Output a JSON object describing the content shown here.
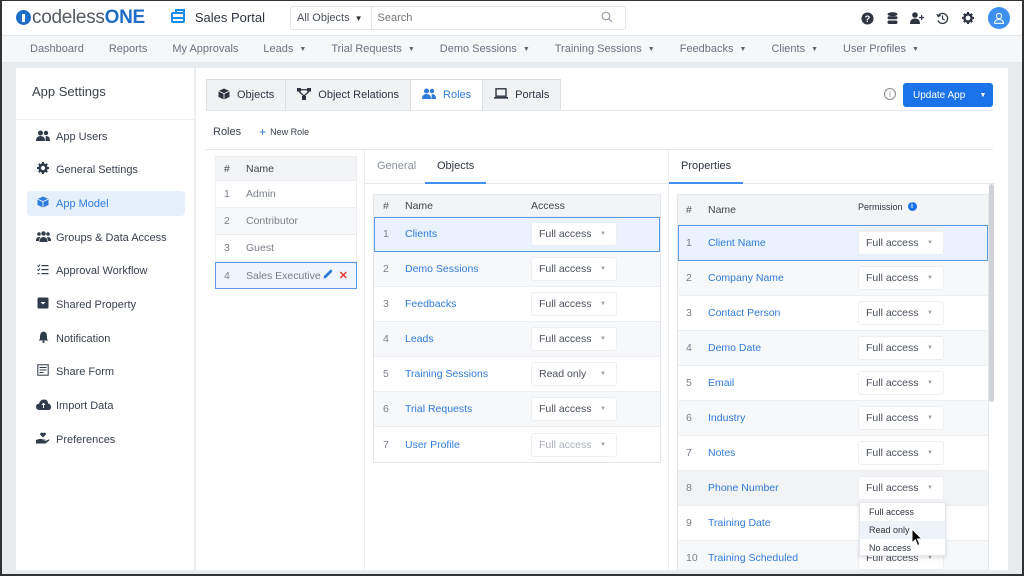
{
  "header": {
    "logo_prefix": "codeless",
    "logo_suffix": "ONE",
    "app_name": "Sales Portal",
    "search": {
      "scope": "All Objects",
      "placeholder": "Search",
      "value": ""
    },
    "icons": [
      "help-icon",
      "database-icon",
      "add-user-icon",
      "history-icon",
      "gear-icon",
      "user-avatar"
    ]
  },
  "nav": {
    "items": [
      {
        "label": "Dashboard",
        "dropdown": false
      },
      {
        "label": "Reports",
        "dropdown": false
      },
      {
        "label": "My Approvals",
        "dropdown": false
      },
      {
        "label": "Leads",
        "dropdown": true
      },
      {
        "label": "Trial Requests",
        "dropdown": true
      },
      {
        "label": "Demo Sessions",
        "dropdown": true
      },
      {
        "label": "Training Sessions",
        "dropdown": true
      },
      {
        "label": "Feedbacks",
        "dropdown": true
      },
      {
        "label": "Clients",
        "dropdown": true
      },
      {
        "label": "User Profiles",
        "dropdown": true
      }
    ]
  },
  "sidebar": {
    "title": "App Settings",
    "items": [
      {
        "label": "App Users",
        "icon": "users-icon"
      },
      {
        "label": "General Settings",
        "icon": "gear-icon"
      },
      {
        "label": "App Model",
        "icon": "cube-icon",
        "active": true
      },
      {
        "label": "Groups & Data Access",
        "icon": "groups-icon"
      },
      {
        "label": "Approval Workflow",
        "icon": "checklist-icon"
      },
      {
        "label": "Shared Property",
        "icon": "inbox-icon"
      },
      {
        "label": "Notification",
        "icon": "bell-icon"
      },
      {
        "label": "Share Form",
        "icon": "form-icon"
      },
      {
        "label": "Import Data",
        "icon": "cloud-upload-icon"
      },
      {
        "label": "Preferences",
        "icon": "hand-heart-icon"
      }
    ]
  },
  "main": {
    "tabs": [
      {
        "label": "Objects"
      },
      {
        "label": "Object Relations"
      },
      {
        "label": "Roles",
        "active": true
      },
      {
        "label": "Portals"
      }
    ],
    "update_button": "Update App",
    "roles_label": "Roles",
    "new_role_label": "New Role",
    "roles_table": {
      "headers": [
        "#",
        "Name"
      ],
      "rows": [
        {
          "n": "1",
          "name": "Admin"
        },
        {
          "n": "2",
          "name": "Contributor"
        },
        {
          "n": "3",
          "name": "Guest"
        },
        {
          "n": "4",
          "name": "Sales Executive",
          "selected": true
        }
      ]
    },
    "sub_tabs": [
      {
        "label": "General"
      },
      {
        "label": "Objects",
        "active": true
      }
    ],
    "objects_table": {
      "headers": [
        "#",
        "Name",
        "Access"
      ],
      "rows": [
        {
          "n": "1",
          "name": "Clients",
          "access": "Full access",
          "selected": true
        },
        {
          "n": "2",
          "name": "Demo Sessions",
          "access": "Full access"
        },
        {
          "n": "3",
          "name": "Feedbacks",
          "access": "Full access"
        },
        {
          "n": "4",
          "name": "Leads",
          "access": "Full access"
        },
        {
          "n": "5",
          "name": "Training Sessions",
          "access": "Read only"
        },
        {
          "n": "6",
          "name": "Trial Requests",
          "access": "Full access"
        },
        {
          "n": "7",
          "name": "User Profile",
          "access": "Full access",
          "disabled": true
        }
      ]
    },
    "properties_tab": "Properties",
    "properties_table": {
      "headers": [
        "#",
        "Name",
        "Permission"
      ],
      "rows": [
        {
          "n": "1",
          "name": "Client Name",
          "permission": "Full access",
          "selected": true
        },
        {
          "n": "2",
          "name": "Company Name",
          "permission": "Full access"
        },
        {
          "n": "3",
          "name": "Contact Person",
          "permission": "Full access"
        },
        {
          "n": "4",
          "name": "Demo Date",
          "permission": "Full access"
        },
        {
          "n": "5",
          "name": "Email",
          "permission": "Full access"
        },
        {
          "n": "6",
          "name": "Industry",
          "permission": "Full access"
        },
        {
          "n": "7",
          "name": "Notes",
          "permission": "Full access"
        },
        {
          "n": "8",
          "name": "Phone Number",
          "permission": "Full access"
        },
        {
          "n": "9",
          "name": "Training Date",
          "permission": ""
        },
        {
          "n": "10",
          "name": "Training Scheduled",
          "permission": "Full access"
        }
      ]
    },
    "permission_dropdown": {
      "options": [
        "Full access",
        "Read only",
        "No access"
      ],
      "hovered": "Read only"
    }
  }
}
